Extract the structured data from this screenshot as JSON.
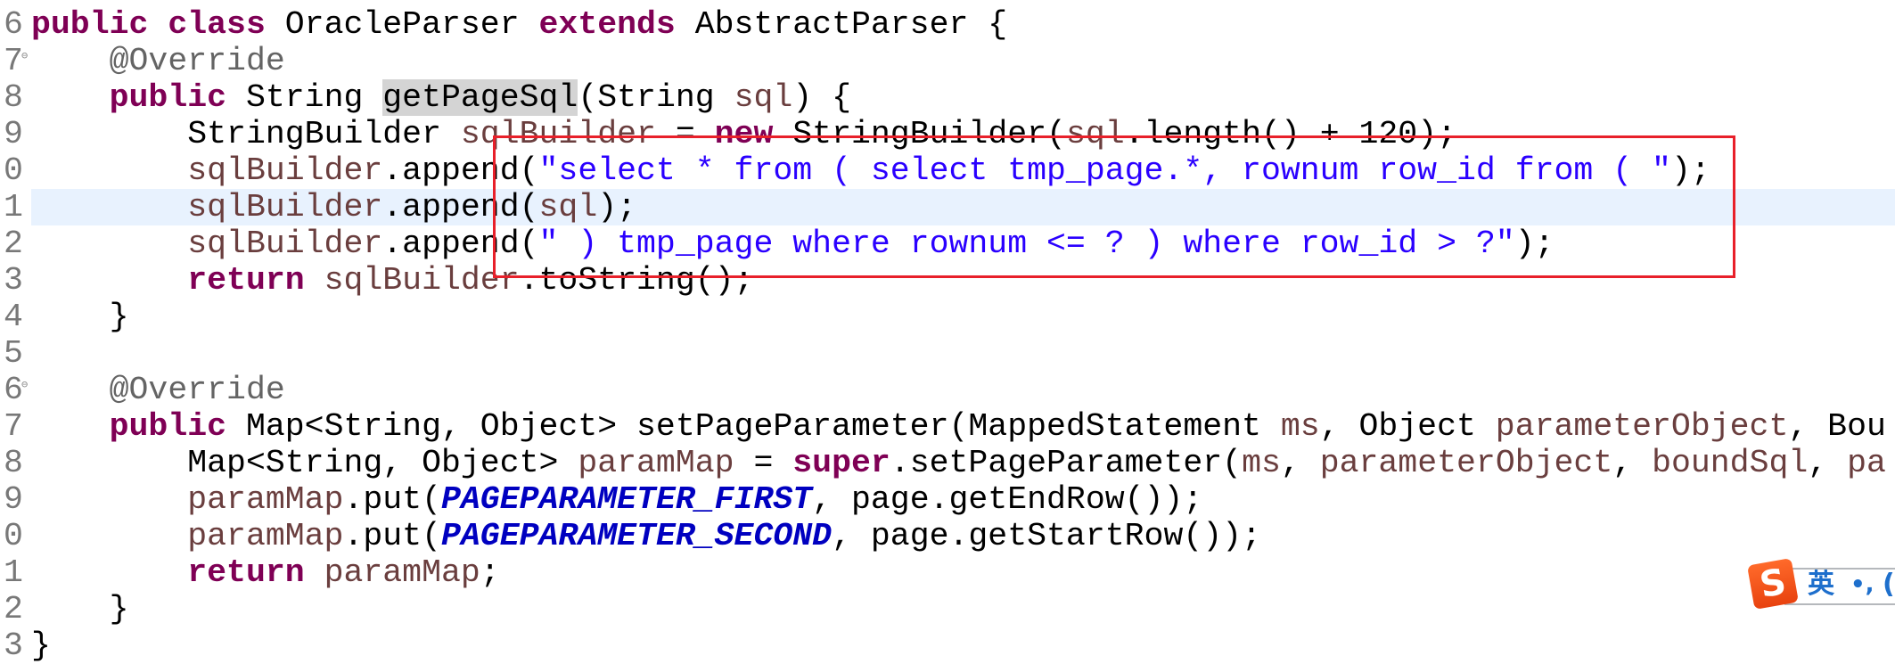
{
  "editor": {
    "colors": {
      "keyword": "#7f0055",
      "string": "#2a00ff",
      "annotation": "#646464",
      "local_variable": "#6a3e3e",
      "static_field": "#0000c0",
      "current_line": "#e8f2fe",
      "annotation_box": "#e8202a"
    },
    "current_line_index": 5,
    "lines": [
      {
        "num": "6",
        "fold": false,
        "tokens": [
          {
            "t": "public",
            "c": "kw"
          },
          {
            "t": " "
          },
          {
            "t": "class",
            "c": "kw"
          },
          {
            "t": " OracleParser "
          },
          {
            "t": "extends",
            "c": "kw"
          },
          {
            "t": " AbstractParser {"
          }
        ]
      },
      {
        "num": "7",
        "fold": true,
        "tokens": [
          {
            "t": "    "
          },
          {
            "t": "@Override",
            "c": "ann"
          }
        ]
      },
      {
        "num": "8",
        "fold": false,
        "tokens": [
          {
            "t": "    "
          },
          {
            "t": "public",
            "c": "kw"
          },
          {
            "t": " String "
          },
          {
            "t": "getPageSql",
            "c": "hl"
          },
          {
            "t": "(String "
          },
          {
            "t": "sql",
            "c": "var"
          },
          {
            "t": ") {"
          }
        ]
      },
      {
        "num": "9",
        "fold": false,
        "tokens": [
          {
            "t": "        StringBuilder "
          },
          {
            "t": "sqlBuilder",
            "c": "var"
          },
          {
            "t": " = "
          },
          {
            "t": "new",
            "c": "kw"
          },
          {
            "t": " StringBuilder("
          },
          {
            "t": "sql",
            "c": "var"
          },
          {
            "t": ".length() + 120);"
          }
        ]
      },
      {
        "num": "0",
        "fold": false,
        "tokens": [
          {
            "t": "        "
          },
          {
            "t": "sqlBuilder",
            "c": "var"
          },
          {
            "t": ".append("
          },
          {
            "t": "\"select * from ( select tmp_page.*, rownum row_id from ( \"",
            "c": "str"
          },
          {
            "t": ");"
          }
        ]
      },
      {
        "num": "1",
        "fold": false,
        "tokens": [
          {
            "t": "        "
          },
          {
            "t": "sqlBuilder",
            "c": "var"
          },
          {
            "t": ".append("
          },
          {
            "t": "sql",
            "c": "var"
          },
          {
            "t": ");"
          }
        ]
      },
      {
        "num": "2",
        "fold": false,
        "tokens": [
          {
            "t": "        "
          },
          {
            "t": "sqlBuilder",
            "c": "var"
          },
          {
            "t": ".append("
          },
          {
            "t": "\" ) tmp_page where rownum <= ? ) where row_id > ?\"",
            "c": "str"
          },
          {
            "t": ");"
          }
        ]
      },
      {
        "num": "3",
        "fold": false,
        "tokens": [
          {
            "t": "        "
          },
          {
            "t": "return",
            "c": "kw"
          },
          {
            "t": " "
          },
          {
            "t": "sqlBuilder",
            "c": "var"
          },
          {
            "t": ".toString();"
          }
        ]
      },
      {
        "num": "4",
        "fold": false,
        "tokens": [
          {
            "t": "    }"
          }
        ]
      },
      {
        "num": "5",
        "fold": false,
        "tokens": []
      },
      {
        "num": "6",
        "fold": true,
        "tokens": [
          {
            "t": "    "
          },
          {
            "t": "@Override",
            "c": "ann"
          }
        ]
      },
      {
        "num": "7",
        "fold": false,
        "tokens": [
          {
            "t": "    "
          },
          {
            "t": "public",
            "c": "kw"
          },
          {
            "t": " Map<String, Object> setPageParameter(MappedStatement "
          },
          {
            "t": "ms",
            "c": "var"
          },
          {
            "t": ", Object "
          },
          {
            "t": "parameterObject",
            "c": "var"
          },
          {
            "t": ", Bou"
          }
        ]
      },
      {
        "num": "8",
        "fold": false,
        "tokens": [
          {
            "t": "        Map<String, Object> "
          },
          {
            "t": "paramMap",
            "c": "var"
          },
          {
            "t": " = "
          },
          {
            "t": "super",
            "c": "kw"
          },
          {
            "t": ".setPageParameter("
          },
          {
            "t": "ms",
            "c": "var"
          },
          {
            "t": ", "
          },
          {
            "t": "parameterObject",
            "c": "var"
          },
          {
            "t": ", "
          },
          {
            "t": "boundSql",
            "c": "var"
          },
          {
            "t": ", "
          },
          {
            "t": "pa",
            "c": "var"
          }
        ]
      },
      {
        "num": "9",
        "fold": false,
        "tokens": [
          {
            "t": "        "
          },
          {
            "t": "paramMap",
            "c": "var"
          },
          {
            "t": ".put("
          },
          {
            "t": "PAGEPARAMETER_FIRST",
            "c": "fld"
          },
          {
            "t": ", page.getEndRow());"
          }
        ]
      },
      {
        "num": "0",
        "fold": false,
        "tokens": [
          {
            "t": "        "
          },
          {
            "t": "paramMap",
            "c": "var"
          },
          {
            "t": ".put("
          },
          {
            "t": "PAGEPARAMETER_SECOND",
            "c": "fld"
          },
          {
            "t": ", page.getStartRow());"
          }
        ]
      },
      {
        "num": "1",
        "fold": false,
        "tokens": [
          {
            "t": "        "
          },
          {
            "t": "return",
            "c": "kw"
          },
          {
            "t": " "
          },
          {
            "t": "paramMap",
            "c": "var"
          },
          {
            "t": ";"
          }
        ]
      },
      {
        "num": "2",
        "fold": false,
        "tokens": [
          {
            "t": "    }"
          }
        ]
      },
      {
        "num": "3",
        "fold": false,
        "tokens": [
          {
            "t": "}"
          }
        ]
      }
    ]
  },
  "ime": {
    "logo": "S",
    "mode": "英",
    "punct": "•,",
    "extra": "("
  }
}
